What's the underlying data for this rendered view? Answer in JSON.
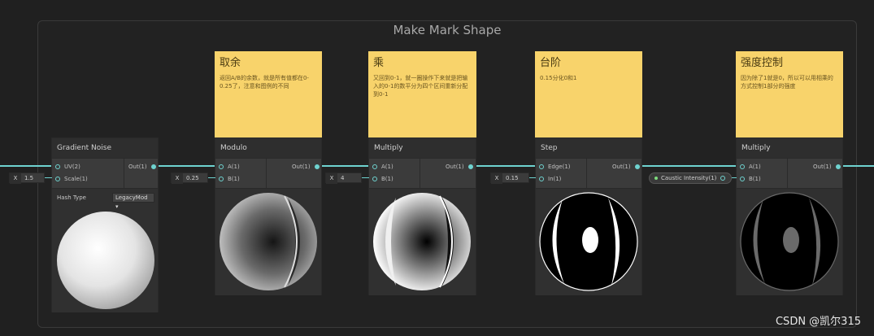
{
  "group": {
    "title": "Make Mark Shape"
  },
  "stickies": [
    {
      "title": "取余",
      "body": "返回A/B的余数，就是所有值都在0-0.25了，注意和图例的不同"
    },
    {
      "title": "乘",
      "body": "又回到0-1，就一圈操作下来就是把输入的0-1的数平分为四个区间重新分配到0-1"
    },
    {
      "title": "台阶",
      "body": "0.15分化0和1"
    },
    {
      "title": "强度控制",
      "body": "因为除了1就是0，所以可以用相乘的方式控制1部分的强度"
    }
  ],
  "gradient_noise": {
    "title": "Gradient Noise",
    "in1": "UV(2)",
    "in2": "Scale(1)",
    "out": "Out(1)",
    "scale_x": "X",
    "scale_value": "1.5",
    "hash_label": "Hash Type",
    "hash_value": "LegacyMod"
  },
  "modulo": {
    "title": "Modulo",
    "in1": "A(1)",
    "in2": "B(1)",
    "out": "Out(1)",
    "x": "X",
    "b_value": "0.25"
  },
  "multiply1": {
    "title": "Multiply",
    "in1": "A(1)",
    "in2": "B(1)",
    "out": "Out(1)",
    "x": "X",
    "b_value": "4"
  },
  "step": {
    "title": "Step",
    "in1": "Edge(1)",
    "in2": "In(1)",
    "out": "Out(1)",
    "x": "X",
    "edge_value": "0.15"
  },
  "multiply2": {
    "title": "Multiply",
    "in1": "A(1)",
    "in2": "B(1)",
    "out": "Out(1)"
  },
  "property_chip": {
    "label": "Caustic Intensity(1)"
  },
  "watermark": "CSDN @凯尔315",
  "colors": {
    "wire": "#6fd3d0",
    "sticky": "#f8d36b",
    "node": "#3b3b3b",
    "background": "#202020"
  }
}
